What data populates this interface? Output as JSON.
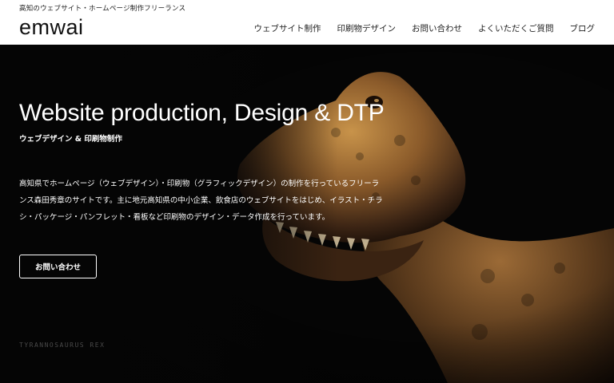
{
  "header": {
    "tagline": "高知のウェブサイト・ホームページ制作フリーランス",
    "logo": "emwai",
    "nav": [
      "ウェブサイト制作",
      "印刷物デザイン",
      "お問い合わせ",
      "よくいただくご質問",
      "ブログ"
    ]
  },
  "hero": {
    "title": "Website production, Design & DTP",
    "subtitle": "ウェブデザイン & 印刷物制作",
    "description_lines": [
      "高知県でホームページ（ウェブデザイン）・印刷物（グラフィックデザイン）の制作を行っているフリーラ",
      "ンス森田秀章のサイトです。主に地元高知県の中小企業、飲食店のウェブサイトをはじめ、イラスト・チラ",
      "シ・パッケージ・パンフレット・看板など印刷物のデザイン・データ作成を行っています。"
    ],
    "cta_label": "お問い合わせ",
    "caption": "TYRANNOSAURUS REX"
  },
  "colors": {
    "hero_background": "#050505",
    "header_background": "#ffffff",
    "text_light": "#ffffff",
    "dino_highlight": "#c8934a"
  },
  "icons": {
    "hero_image": "tyrannosaurus-rex-photo"
  }
}
